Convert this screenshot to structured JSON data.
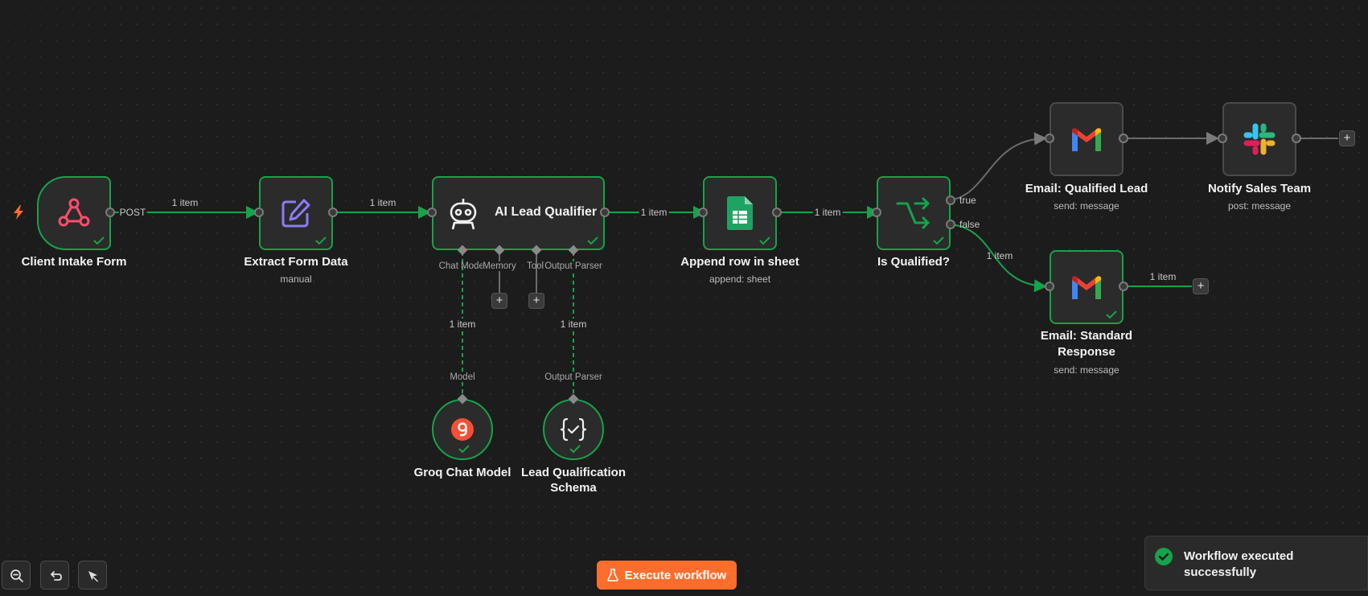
{
  "nodes": {
    "client_intake": {
      "title": "Client Intake Form",
      "edge_out": "POST"
    },
    "extract": {
      "title": "Extract Form Data",
      "subtitle": "manual"
    },
    "ai": {
      "title": "AI Lead Qualifier",
      "ports": [
        "Chat Model",
        "Memory",
        "Tool",
        "Output Parser"
      ]
    },
    "append": {
      "title": "Append row in sheet",
      "subtitle": "append: sheet"
    },
    "if": {
      "title": "Is Qualified?",
      "true_label": "true",
      "false_label": "false"
    },
    "email_qualified": {
      "title": "Email: Qualified Lead",
      "subtitle": "send: message"
    },
    "notify": {
      "title": "Notify Sales Team",
      "subtitle": "post: message"
    },
    "email_standard": {
      "title_line1": "Email: Standard",
      "title_line2": "Response",
      "subtitle": "send: message"
    },
    "groq": {
      "title": "Groq Chat Model",
      "port": "Model"
    },
    "schema": {
      "title_line1": "Lead Qualification",
      "title_line2": "Schema",
      "port": "Output Parser"
    }
  },
  "edges": {
    "item_label": "1 item"
  },
  "plus": "+",
  "execute_button": {
    "label": "Execute workflow"
  },
  "toast": {
    "message": "Workflow executed successfully"
  },
  "colors": {
    "background": "#1c1c1c",
    "node_bg": "#2b2b2b",
    "success": "#16a34a",
    "accent": "#ff6d2d"
  },
  "icons": {
    "trigger": "lightning-icon",
    "client_intake": "webhook-icon",
    "extract": "edit-pen-icon",
    "ai": "robot-icon",
    "append": "google-sheets-icon",
    "if": "branch-split-icon",
    "gmail": "gmail-icon",
    "slack": "slack-icon",
    "groq": "groq-icon",
    "schema": "braces-check-icon",
    "zoom": "zoom-out-icon",
    "undo": "undo-icon",
    "tidy": "tidy-up-icon",
    "flask": "flask-icon",
    "success": "check-circle-icon"
  }
}
